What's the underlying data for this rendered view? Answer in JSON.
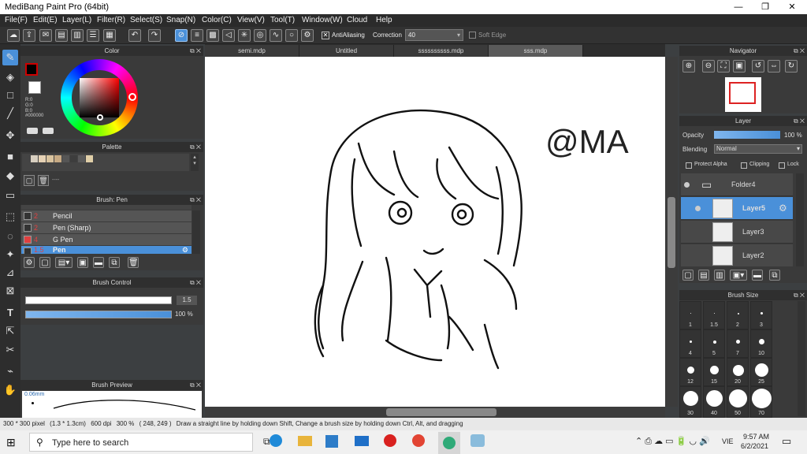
{
  "window": {
    "title": "MediBang Paint Pro (64bit)",
    "minimize": "—",
    "maximize": "❐",
    "close": "✕"
  },
  "menu": [
    "File(F)",
    "Edit(E)",
    "Layer(L)",
    "Filter(R)",
    "Select(S)",
    "Snap(N)",
    "Color(C)",
    "View(V)",
    "Tool(T)",
    "Window(W)",
    "Cloud",
    "Help"
  ],
  "toolbar": {
    "antialias_label": "AntiAliasing",
    "correction_label": "Correction",
    "correction_value": "40",
    "soft_edge_label": "Soft Edge"
  },
  "colors": {
    "accent": "#4a90d9",
    "main_color": "#000000",
    "secondary_color": "#ffffff",
    "brush_red": "#e04040"
  },
  "color_panel": {
    "title": "Color",
    "r": "R:0",
    "g": "G:0",
    "b": "B:0",
    "hex": "#000000"
  },
  "palette_panel": {
    "title": "Palette",
    "dash": "----"
  },
  "brush_panel": {
    "title": "Brush: Pen",
    "items": [
      {
        "num": "2",
        "label": "Pencil"
      },
      {
        "num": "2",
        "label": "Pen (Sharp)"
      },
      {
        "num": "4",
        "label": "G Pen"
      },
      {
        "num": "1.5",
        "label": "Pen"
      }
    ]
  },
  "brush_control": {
    "title": "Brush Control",
    "size_value": "1.5",
    "opacity_value": "100 %"
  },
  "brush_preview": {
    "title": "Brush Preview",
    "size": "0.06mm"
  },
  "doc_tabs": [
    "semi.mdp",
    "Untitled",
    "ssssssssss.mdp",
    "sss.mdp"
  ],
  "canvas": {
    "watermark": "@MA"
  },
  "navigator": {
    "title": "Navigator"
  },
  "layer_panel": {
    "title": "Layer",
    "opacity_label": "Opacity",
    "opacity_value": "100 %",
    "blending_label": "Blending",
    "blending_value": "Normal",
    "protect_alpha": "Protect Alpha",
    "clipping": "Clipping",
    "lock": "Lock",
    "layers": [
      "Folder4",
      "Layer5",
      "Layer3",
      "Layer2"
    ]
  },
  "brush_size_panel": {
    "title": "Brush Size",
    "sizes": [
      "1",
      "1.5",
      "2",
      "3",
      "4",
      "5",
      "7",
      "10",
      "12",
      "15",
      "20",
      "25",
      "30",
      "40",
      "50",
      "70"
    ]
  },
  "status": {
    "dimensions": "300 * 300 pixel",
    "physical": "(1.3 * 1.3cm)",
    "dpi": "600 dpi",
    "zoom": "300 %",
    "coords": "( 248, 249 )",
    "hint": "Draw a straight line by holding down Shift, Change a brush size by holding down Ctrl, Alt, and dragging"
  },
  "taskbar": {
    "search_placeholder": "Type here to search",
    "lang": "VIE",
    "time": "9:57 AM",
    "date": "6/2/2021"
  }
}
